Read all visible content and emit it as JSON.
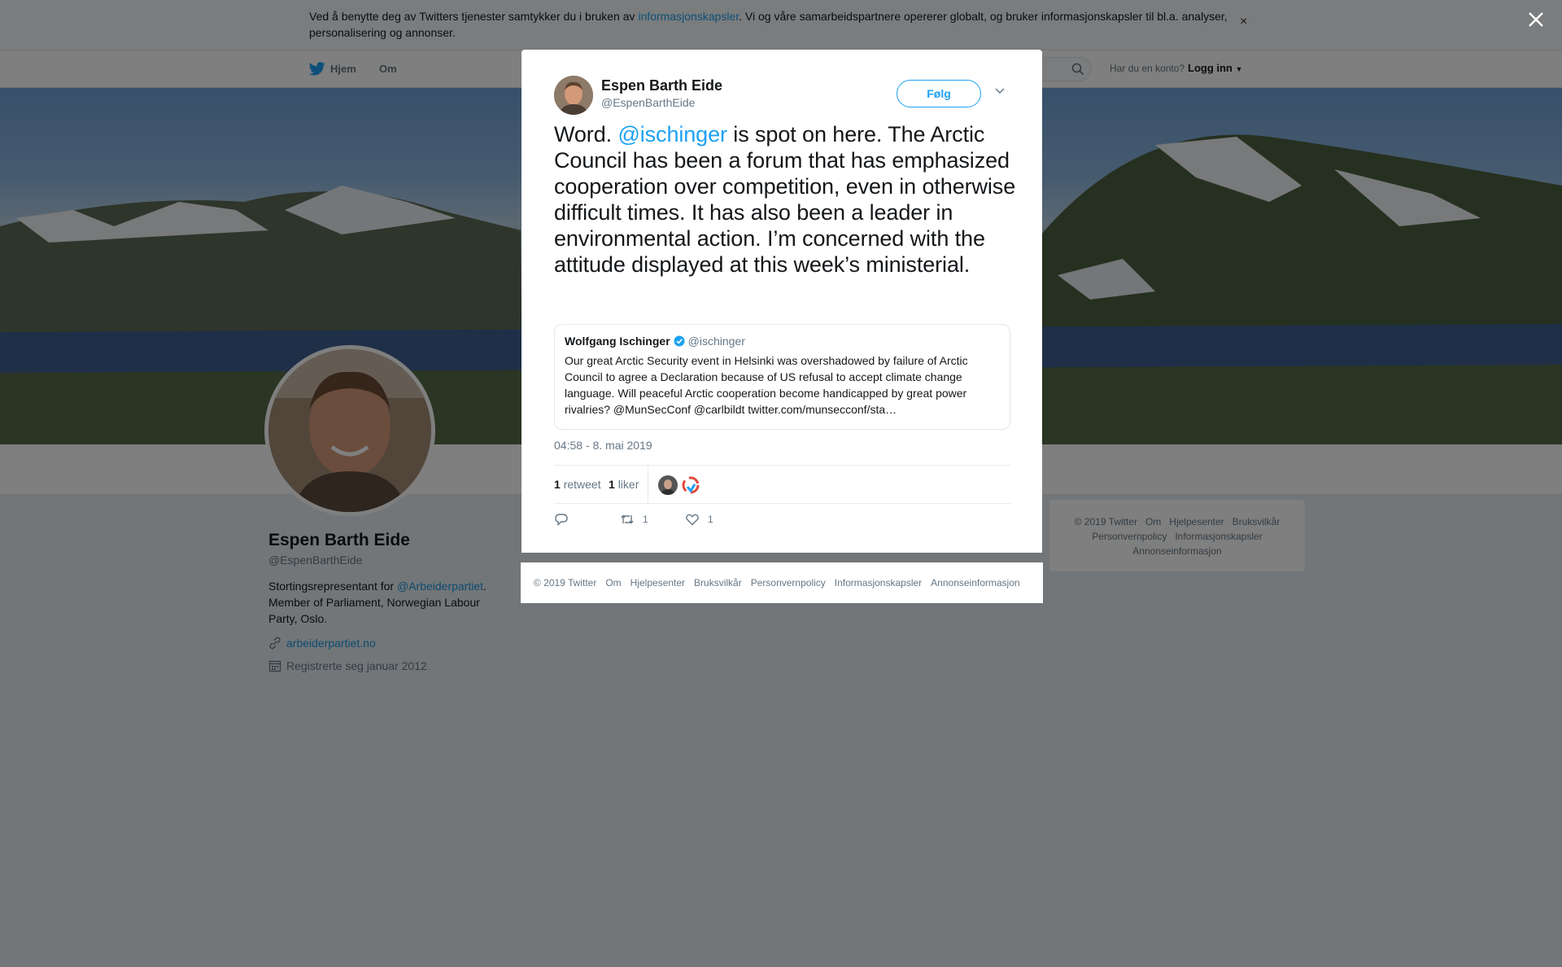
{
  "cookie": {
    "text_before": "Ved å benytte deg av Twitters tjenester samtykker du i bruken av ",
    "link": "informasjonskapsler",
    "text_after": ". Vi og våre samarbeidspartnere opererer globalt, og bruker informasjonskapsler til bl.a. analyser, personalisering og annonser.",
    "close": "×"
  },
  "nav": {
    "home": "Hjem",
    "about": "Om",
    "account_question": "Har du en konto?",
    "login": "Logg inn"
  },
  "profile": {
    "name": "Espen Barth Eide",
    "handle": "@EspenBarthEide",
    "bio_before": "Stortingsrepresentant for ",
    "bio_link": "@Arbeiderpartiet",
    "bio_after": ". Member of Parliament, Norwegian Labour Party, Oslo.",
    "website": "arbeiderpartiet.no",
    "joined": "Registrerte seg januar 2012"
  },
  "right_footer": {
    "items": [
      "© 2019 Twitter",
      "Om",
      "Hjelpesenter",
      "Bruksvilkår",
      "Personvernpolicy",
      "Informasjonskapsler",
      "Annonseinformasjon"
    ]
  },
  "tweet": {
    "author_name": "Espen Barth Eide",
    "author_handle": "@EspenBarthEide",
    "follow_label": "Følg",
    "text_before": "Word. ",
    "mention": "@ischinger",
    "text_after": " is spot on here. The Arctic Council has been a forum that has emphasized cooperation over competition, even in otherwise difficult times. It has also been a leader in environmental action. I’m concerned with the attitude displayed at this week’s ministerial.",
    "quote": {
      "name": "Wolfgang Ischinger",
      "handle": "@ischinger",
      "text": "Our great Arctic Security event in Helsinki was overshadowed by failure of Arctic Council to agree a Declaration because of US refusal to accept climate change language. Will peaceful Arctic cooperation become handicapped by great power rivalries? @MunSecConf @carlbildt twitter.com/munsecconf/sta…"
    },
    "timestamp": "04:58 - 8. mai 2019",
    "retweet_count": "1",
    "retweet_label": "retweet",
    "like_count": "1",
    "like_label": "liker",
    "action_retweet_count": "1",
    "action_like_count": "1"
  },
  "modal_footer": {
    "items": [
      "© 2019 Twitter",
      "Om",
      "Hjelpesenter",
      "Bruksvilkår",
      "Personvernpolicy",
      "Informasjonskapsler",
      "Annonseinformasjon"
    ]
  },
  "colors": {
    "twitter_blue": "#1da1f2",
    "link_blue": "#1b95e0",
    "muted_text": "#657786",
    "overlay": "rgba(0,0,0,0.5)"
  }
}
